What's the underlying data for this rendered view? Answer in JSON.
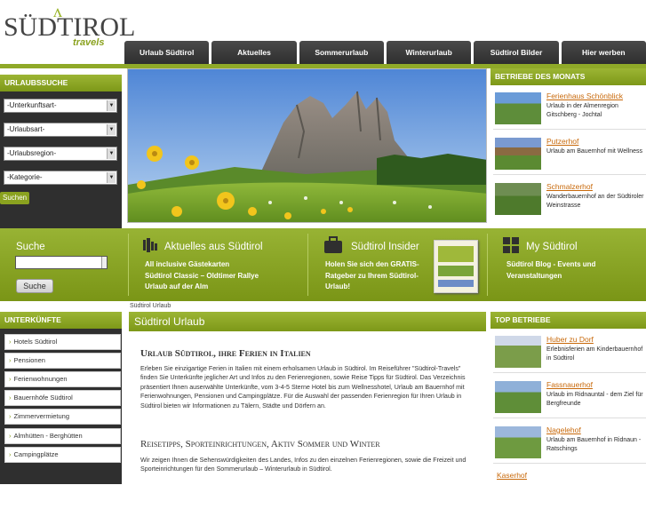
{
  "logo": {
    "brand": "SÜDTIROL",
    "tag": "travels"
  },
  "nav": [
    "Urlaub Südtirol",
    "Aktuelles",
    "Sommerurlaub",
    "Winterurlaub",
    "Südtirol Bilder",
    "Hier werben"
  ],
  "urlaubssuche": {
    "title": "URLAUBSSUCHE",
    "selects": [
      "-Unterkunftsart-",
      "-Urlaubsart-",
      "-Urlaubsregion-",
      "-Kategorie-"
    ],
    "button": "Suchen"
  },
  "betriebe_des_monats": {
    "title": "BETRIEBE DES MONATS",
    "items": [
      {
        "name": "Ferienhaus Schönblick",
        "desc": "Urlaub in der Almenregion Gitschberg - Jochtal"
      },
      {
        "name": "Putzerhof",
        "desc": "Urlaub am Bauernhof mit Wellness"
      },
      {
        "name": "Schmalzerhof",
        "desc": "Wanderbauernhof an der Südtiroler Weinstrasse"
      }
    ]
  },
  "band": {
    "suche": {
      "title": "Suche",
      "button": "Suche"
    },
    "aktuelles": {
      "title": "Aktuelles aus Südtirol",
      "lines": [
        "All inclusive Gästekarten",
        "Südtirol Classic – Oldtimer Rallye",
        "Urlaub auf der Alm"
      ]
    },
    "insider": {
      "title": "Südtirol Insider",
      "lines": [
        "Holen Sie sich den GRATIS-",
        "Ratgeber zu Ihrem Südtirol-",
        "Urlaub!"
      ]
    },
    "mein": {
      "title": "My Südtirol",
      "lines": [
        "Südtirol Blog - Events und",
        "Veranstaltungen"
      ]
    }
  },
  "breadcrumb": "Südtirol Urlaub",
  "unterkuenfte": {
    "title": "UNTERKÜNFTE",
    "items": [
      "Hotels Südtirol",
      "Pensionen",
      "Ferienwohnungen",
      "Bauernhöfe Südtirol",
      "Zimmervermietung",
      "Almhütten - Berghütten",
      "Campingplätze"
    ]
  },
  "content": {
    "header": "Südtirol Urlaub",
    "h1": "Urlaub Südtirol, ihre Ferien in Italien",
    "p1": "Erleben Sie einzigartige Ferien in Italien mit einem erholsamen Urlaub in Südtirol. Im Reiseführer \"Südtirol-Travels\" finden Sie Unterkünfte jeglicher Art und Infos zu den Ferienregionen, sowie Reise Tipps für Südtirol. Das Verzeichnis präsentiert Ihnen auserwählte Unterkünfte, vom 3-4-5 Sterne Hotel bis zum Wellnesshotel, Urlaub am Bauernhof mit Ferienwohnungen, Pensionen und Campingplätze. Für die Auswahl der passenden Ferienregion für Ihren Urlaub in Südtirol bieten wir Informationen zu Tälern, Städte und Dörfern an.",
    "h2": "Reisetipps, Sporteinrichtungen, Aktiv Sommer und Winter",
    "p2": "Wir zeigen Ihnen die Sehenswürdigkeiten des Landes, Infos zu den einzelnen Ferienregionen, sowie die Freizeit und Sporteinrichtungen für den Sommerurlaub – Winterurlaub in Südtirol."
  },
  "top_betriebe": {
    "title": "TOP BETRIEBE",
    "items": [
      {
        "name": "Huber zu Dorf",
        "desc": "Erlebnisferien am Kinderbauernhof in Südtirol"
      },
      {
        "name": "Fassnauerhof",
        "desc": "Urlaub im Ridnauntal - dem Ziel für Bergfreunde"
      },
      {
        "name": "Nagelehof",
        "desc": "Urlaub am Bauernhof in Ridnaun - Ratschings"
      },
      {
        "name": "Kaserhof",
        "desc": ""
      }
    ]
  }
}
